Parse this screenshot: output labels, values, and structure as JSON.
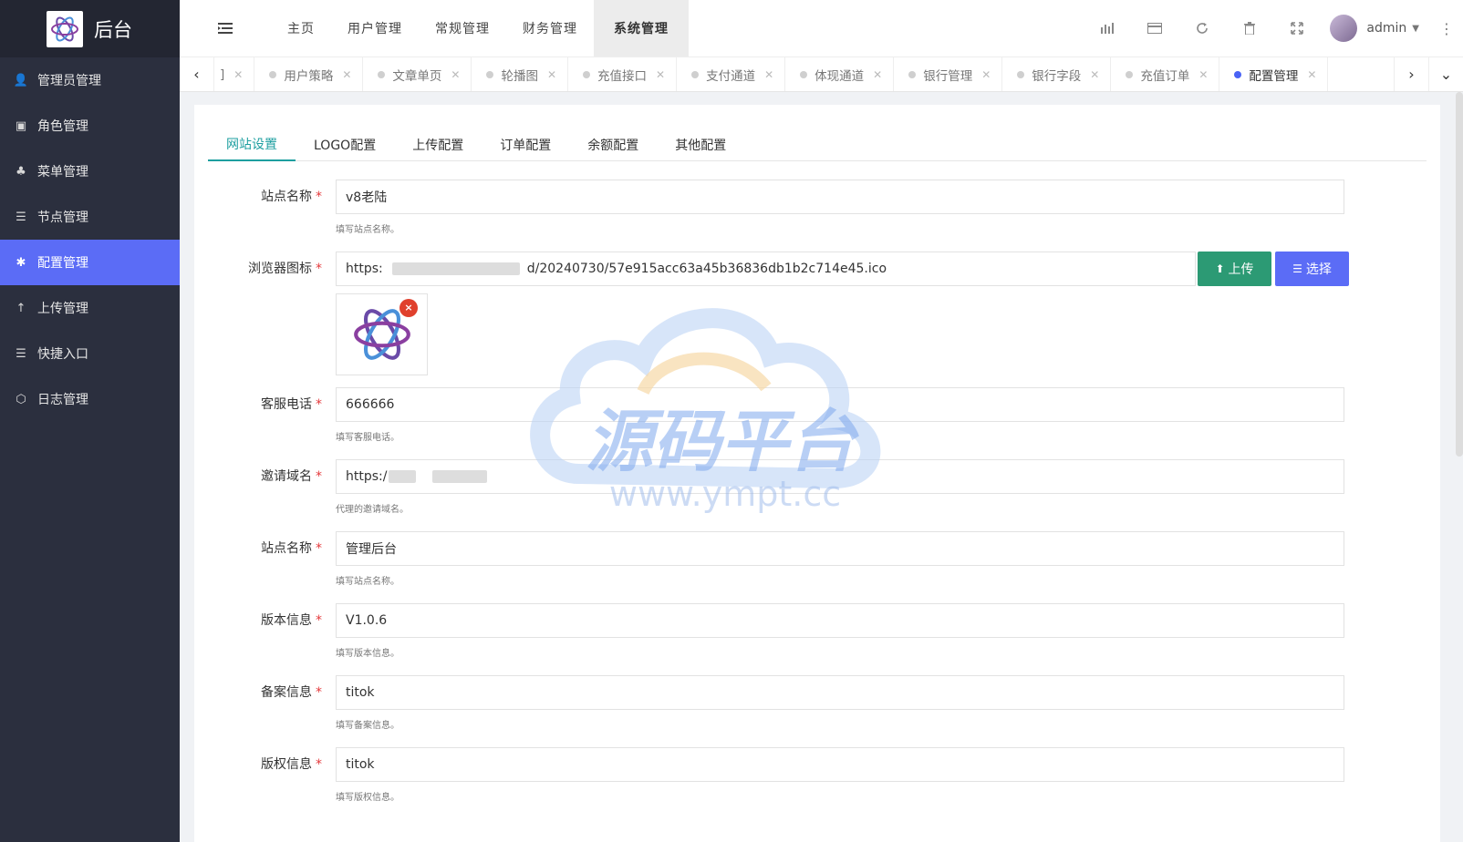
{
  "brand": {
    "title": "后台"
  },
  "sidebar": {
    "items": [
      {
        "label": "管理员管理",
        "icon": "user-icon"
      },
      {
        "label": "角色管理",
        "icon": "role-icon"
      },
      {
        "label": "菜单管理",
        "icon": "tree-icon"
      },
      {
        "label": "节点管理",
        "icon": "list-icon"
      },
      {
        "label": "配置管理",
        "icon": "asterisk-icon",
        "active": true
      },
      {
        "label": "上传管理",
        "icon": "arrow-up-icon"
      },
      {
        "label": "快捷入口",
        "icon": "list-icon"
      },
      {
        "label": "日志管理",
        "icon": "cube-icon"
      }
    ]
  },
  "topnav": {
    "items": [
      "主页",
      "用户管理",
      "常规管理",
      "财务管理",
      "系统管理"
    ],
    "active_index": 4
  },
  "header": {
    "user_name": "admin"
  },
  "tabs": {
    "partial_label": "]",
    "items": [
      "用户策略",
      "文章单页",
      "轮播图",
      "充值接口",
      "支付通道",
      "体现通道",
      "银行管理",
      "银行字段",
      "充值订单",
      "配置管理"
    ],
    "active_index": 9
  },
  "config_tabs": [
    "网站设置",
    "LOGO配置",
    "上传配置",
    "订单配置",
    "余额配置",
    "其他配置"
  ],
  "form": {
    "site_name": {
      "label": "站点名称",
      "value": "v8老陆",
      "help": "填写站点名称。"
    },
    "favicon": {
      "label": "浏览器图标",
      "prefix": "https:",
      "suffix": "d/20240730/57e915acc63a45b36836db1b2c714e45.ico",
      "upload": "上传",
      "select": "选择"
    },
    "service_phone": {
      "label": "客服电话",
      "value": "666666",
      "help": "填写客服电话。"
    },
    "invite_domain": {
      "label": "邀请域名",
      "value": "https:/",
      "help": "代理的邀请域名。"
    },
    "site_name2": {
      "label": "站点名称",
      "value": "管理后台",
      "help": "填写站点名称。"
    },
    "version": {
      "label": "版本信息",
      "value": "V1.0.6",
      "help": "填写版本信息。"
    },
    "icp": {
      "label": "备案信息",
      "value": "titok",
      "help": "填写备案信息。"
    },
    "copyright": {
      "label": "版权信息",
      "value": "titok",
      "help": "填写版权信息。"
    }
  },
  "watermark": {
    "main": "源码平台",
    "url": "www.ympt.cc"
  },
  "colors": {
    "sidebar_bg": "#2b2f3e",
    "active_menu": "#5b6cf6",
    "upload_btn": "#2c9a74",
    "select_btn": "#5b6cf6",
    "tab_active": "#1e9fa0"
  }
}
